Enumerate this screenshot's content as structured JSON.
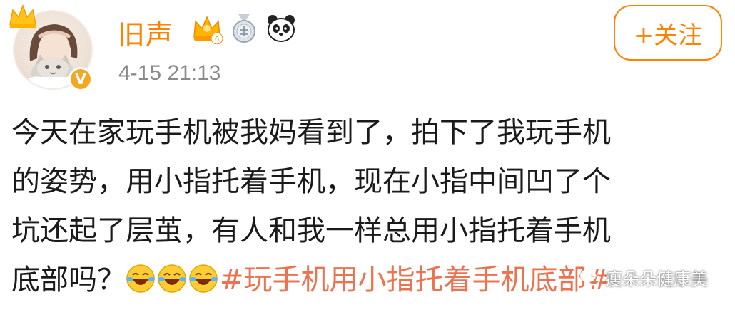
{
  "user": {
    "name": "旧声",
    "verified_mark": "V",
    "member_level": "6",
    "timestamp": "4-15 21:13"
  },
  "follow_button": {
    "label": "+关注"
  },
  "post": {
    "lines": [
      "今天在家玩手机被我妈看到了，拍下了我玩手机",
      "的姿势，用小指托着手机，现在小指中间凹了个",
      "坑还起了层茧，有人和我一样总用小指托着手机"
    ],
    "last_line_text": "底部吗？",
    "emojis": [
      "laugh-cry-emoji",
      "laugh-cry-emoji",
      "laugh-cry-emoji"
    ],
    "hashtag": "#玩手机用小指托着手机底部#"
  },
  "watermark": {
    "text": "瘦朵朵健康美"
  },
  "colors": {
    "username": "#ff8200",
    "follow": "#ff8200",
    "hashtag": "#eb7350",
    "timestamp": "#8a8a8a"
  }
}
